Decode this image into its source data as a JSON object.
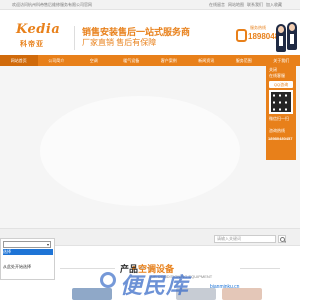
{
  "topbar": {
    "welcome": "欢迎访问杭州科帝售后维修服务有限公司官网",
    "links": [
      "在线留言",
      "网站地图",
      "联系我们",
      "加入收藏"
    ]
  },
  "header": {
    "logo_en": "Kedia",
    "logo_cn": "科帝亚",
    "slogan_main": "销售安装售后一站式服务商",
    "slogan_sub": "厂家直销 售后有保障",
    "hotline_label": "服务热线",
    "hotline_number": "1898048"
  },
  "nav": {
    "items": [
      "网站首页",
      "公司简介",
      "空调",
      "暖气设备",
      "客户案例",
      "新闻资讯",
      "服务范围",
      "关于我们"
    ]
  },
  "side_panel": {
    "close": "关闭",
    "title": "在线客服",
    "qq": "QQ咨询",
    "scan": "微信扫一扫",
    "hotline_label": "咨询热线",
    "hotline_number": "18980480457"
  },
  "search": {
    "placeholder": "请输入关键词"
  },
  "dropdown": {
    "selected": "",
    "options": [
      "选择",
      "",
      "从此处开始选择",
      ""
    ]
  },
  "section": {
    "title_pre": "产品",
    "title": "空调设备",
    "subtitle": "AIR CONDITIONING EQUIPMENT"
  },
  "watermark": {
    "text": "便民库",
    "sub": "bianminku.cn"
  },
  "colors": {
    "brand": "#e8801a",
    "nav_active": "#d06a0b",
    "highlight": "#1e74d6"
  }
}
